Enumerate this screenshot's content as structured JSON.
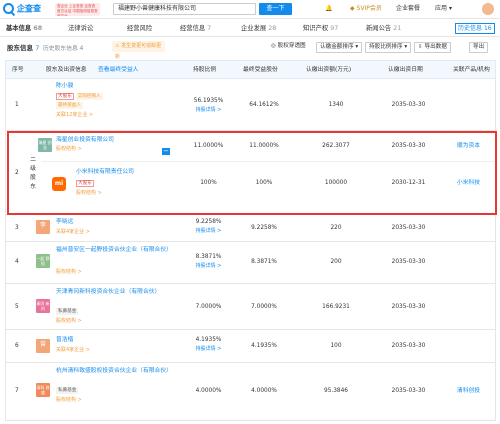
{
  "header": {
    "logo_text": "企查查",
    "logo_sub": "Qcc.com",
    "ad_text": "查企业 上企查查 企查查官方认证 中国信用信息查询平台",
    "search_value": "福建野小兽健康科技有限公司",
    "search_btn": "查一下",
    "vip": "SVIP会员",
    "enterprise": "企业套餐",
    "app": "应用"
  },
  "tabs": [
    {
      "label": "基本信息",
      "count": "68"
    },
    {
      "label": "法律诉讼",
      "count": ""
    },
    {
      "label": "经营风险",
      "count": ""
    },
    {
      "label": "经营信息",
      "count": "7"
    },
    {
      "label": "企业发展",
      "count": "28"
    },
    {
      "label": "知识产权",
      "count": "97"
    },
    {
      "label": "新闻公告",
      "count": "21"
    },
    {
      "label": "历史信息",
      "count": "16"
    }
  ],
  "shareholders": {
    "title": "股东信息",
    "count": "7",
    "history": "历史股东信息 4",
    "notice": "发生变更可追踪更新",
    "ctrl_chart": "股权穿透图",
    "ctrl_recognize": "认缴金额排序",
    "ctrl_ratio": "持股比例排序",
    "ctrl_export": "导出数据",
    "ctrl_report": "导出"
  },
  "columns": {
    "idx": "序号",
    "name": "股东及出资信息",
    "name_link": "查看最终受益人",
    "ratio": "持股比例",
    "final_ratio": "最终受益股份",
    "amount": "认缴出资额(万元)",
    "date": "认缴出资日期",
    "related": "关联产品/机构"
  },
  "rows": [
    {
      "idx": "1",
      "name": "陈小骏",
      "tag1": "大股东",
      "tag2": "实际控制人",
      "tag3": "最终受益人",
      "sub": "关联12家企业 >",
      "ratio": "56.1935%",
      "detail": "持股详情 >",
      "final_ratio": "64.1612%",
      "amount": "1340",
      "date": "2035-03-30",
      "related": "",
      "avatar": "",
      "avatar_color": "#ffffff"
    },
    {
      "idx": "2",
      "name": "海星创业投资有限公司",
      "sub": "股权结构 >",
      "ratio": "11.0000%",
      "final_ratio": "11.0000%",
      "amount": "262.3077",
      "date": "2035-03-30",
      "related": "顺为资本",
      "avatar": "海星 创业",
      "avatar_color": "#7fb8a8"
    },
    {
      "idx": "",
      "name": "小米科技有限责任公司",
      "tag1": "大股东",
      "sub": "股权结构 >",
      "ratio": "100%",
      "final_ratio": "100%",
      "amount": "100000",
      "date": "2030-12-31",
      "related": "小米科技",
      "avatar": "mi",
      "avatar_color": "#ff6900",
      "level_label": "二级股东"
    },
    {
      "idx": "3",
      "name": "李晓远",
      "sub": "关联4家企业 >",
      "ratio": "9.2258%",
      "detail": "持股详情 >",
      "final_ratio": "9.2258%",
      "amount": "220",
      "date": "2035-03-30",
      "related": "",
      "avatar": "李",
      "avatar_color": "#f3a778"
    },
    {
      "idx": "4",
      "name": "福州普安区一起野投资合伙企业（有限合伙）",
      "sub": "股权结构 >",
      "ratio": "8.3871%",
      "detail": "持股详情 >",
      "final_ratio": "8.3871%",
      "amount": "200",
      "date": "2035-03-30",
      "related": "",
      "avatar": "一起 野投",
      "avatar_color": "#8fbf8a"
    },
    {
      "idx": "5",
      "name": "天津青冈新科投资合伙企业（有限合伙）",
      "tag_gray": "私募基金",
      "sub": "股权结构 >",
      "ratio": "7.0000%",
      "final_ratio": "7.0000%",
      "amount": "166.9231",
      "date": "2035-03-30",
      "related": "",
      "avatar": "青冈 新科",
      "avatar_color": "#e8739c"
    },
    {
      "idx": "6",
      "name": "曾浩楷",
      "sub": "关联4家企业 >",
      "ratio": "4.1935%",
      "detail": "持股详情 >",
      "final_ratio": "4.1935%",
      "amount": "100",
      "date": "2035-03-30",
      "related": "",
      "avatar": "曾",
      "avatar_color": "#f3a778"
    },
    {
      "idx": "7",
      "name": "杭州清科致盛股权投资合伙企业（有限合伙）",
      "tag_gray": "私募基金",
      "sub": "股权结构 >",
      "ratio": "4.0000%",
      "final_ratio": "4.0000%",
      "amount": "95.3846",
      "date": "2035-03-30",
      "related": "清科创投",
      "avatar": "清科 致盛",
      "avatar_color": "#f08a5d"
    }
  ]
}
